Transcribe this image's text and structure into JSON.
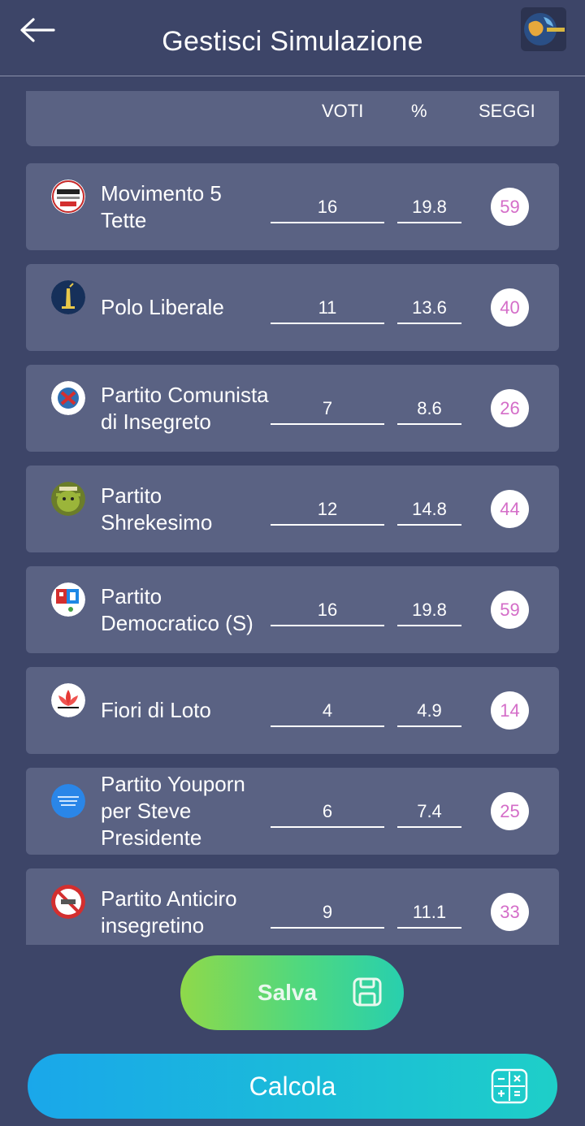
{
  "header": {
    "title": "Gestisci Simulazione",
    "back_icon": "arrow-left-icon",
    "logo_icon": "globe-logo-icon"
  },
  "table": {
    "col_voti": "VOTI",
    "col_pct": "%",
    "col_seggi": "SEGGI"
  },
  "parties": [
    {
      "name": "Movimento 5 Tette",
      "voti": "16",
      "pct": "19.8",
      "seggi": "59",
      "icon": "movimento-logo-icon"
    },
    {
      "name": "Polo Liberale",
      "voti": "11",
      "pct": "13.6",
      "seggi": "40",
      "icon": "statue-of-liberty-logo-icon"
    },
    {
      "name": "Partito Comunista di Insegreto",
      "voti": "7",
      "pct": "8.6",
      "seggi": "26",
      "icon": "hammer-sickle-logo-icon"
    },
    {
      "name": "Partito Shrekesimo",
      "voti": "12",
      "pct": "14.8",
      "seggi": "44",
      "icon": "shrek-logo-icon"
    },
    {
      "name": "Partito Democratico (S)",
      "voti": "16",
      "pct": "19.8",
      "seggi": "59",
      "icon": "pd-logo-icon"
    },
    {
      "name": "Fiori di Loto",
      "voti": "4",
      "pct": "4.9",
      "seggi": "14",
      "icon": "lotus-flower-logo-icon"
    },
    {
      "name": "Partito Youporn per Steve Presidente",
      "voti": "6",
      "pct": "7.4",
      "seggi": "25",
      "icon": "blue-circle-logo-icon"
    },
    {
      "name": "Partito Anticiro insegretino",
      "voti": "9",
      "pct": "11.1",
      "seggi": "33",
      "icon": "no-ciro-logo-icon"
    }
  ],
  "actions": {
    "salva_label": "Salva",
    "salva_icon": "save-floppy-icon",
    "calcola_label": "Calcola",
    "calcola_icon": "calculator-icon"
  },
  "colors": {
    "background": "#3d4568",
    "card": "#5a6283",
    "seggi_text": "#d46dc8"
  }
}
